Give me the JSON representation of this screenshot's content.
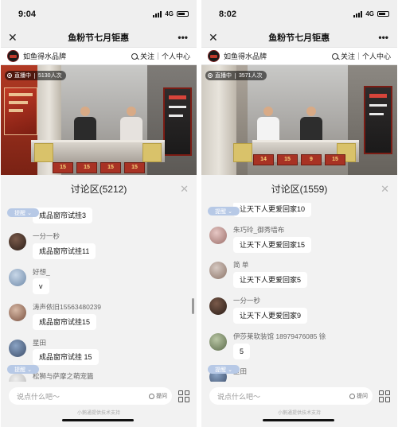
{
  "screens": [
    {
      "status": {
        "time": "9:04",
        "network": "4G"
      },
      "nav": {
        "title": "鱼粉节七月钜惠",
        "close": "✕",
        "more": "•••"
      },
      "brand": {
        "name": "如鱼得水品牌",
        "follow": "关注",
        "profile": "个人中心"
      },
      "live": {
        "status": "直播中",
        "viewers": "5130人次"
      },
      "video_boxes": [
        "15",
        "15",
        "15",
        "15"
      ],
      "discussion": {
        "title": "讨论区(5212)",
        "close": "✕"
      },
      "mention_pills": [
        "提醒",
        "提醒"
      ],
      "comments": [
        {
          "name": "",
          "text": "成品窗帘试挂3"
        },
        {
          "name": "一分一秒",
          "text": "成品窗帘试挂11"
        },
        {
          "name": "好想_",
          "text": "v"
        },
        {
          "name": "涛声依旧15563480239",
          "text": "成品窗帘试挂15"
        },
        {
          "name": "星田",
          "text": "成品窗帘试挂 15"
        },
        {
          "name": "松狮与萨摩之萌宠篇",
          "text": ""
        }
      ],
      "input": {
        "placeholder": "说点什么吧～",
        "ask": "提问"
      },
      "footer": "小鹅通提供技术支持"
    },
    {
      "status": {
        "time": "8:02",
        "network": "4G"
      },
      "nav": {
        "title": "鱼粉节七月钜惠",
        "close": "✕",
        "more": "•••"
      },
      "brand": {
        "name": "如鱼得水品牌",
        "follow": "关注",
        "profile": "个人中心"
      },
      "live": {
        "status": "直播中",
        "viewers": "3571人次"
      },
      "video_boxes": [
        "14",
        "15",
        "9",
        "15"
      ],
      "discussion": {
        "title": "讨论区(1559)",
        "close": "✕"
      },
      "mention_pills": [
        "提醒",
        "提醒"
      ],
      "comments": [
        {
          "name": "",
          "text": "让天下人更爱回家10"
        },
        {
          "name": "朱巧玲_御秀墙布",
          "text": "让天下人更爱回家15"
        },
        {
          "name": "简 单",
          "text": "让天下人更爱回家5"
        },
        {
          "name": "一分一秒",
          "text": "让天下人更爱回家9"
        },
        {
          "name": "伊莎莱软装馆 18979476085 徐",
          "text": "5"
        },
        {
          "name": "星田",
          "text": ""
        }
      ],
      "input": {
        "placeholder": "说点什么吧～",
        "ask": "提问"
      },
      "footer": "小鹅通提供技术支持"
    }
  ]
}
